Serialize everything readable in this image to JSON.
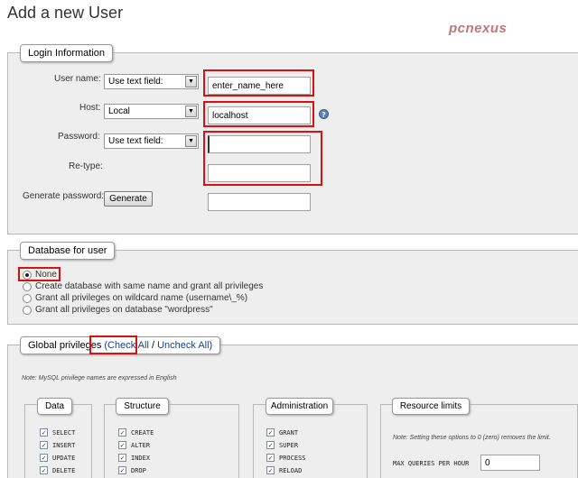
{
  "page": {
    "title": "Add a new User",
    "watermark": "pcnexus"
  },
  "login": {
    "legend": "Login Information",
    "username_label": "User name:",
    "username_mode": "Use text field:",
    "username_value": "enter_name_here",
    "host_label": "Host:",
    "host_mode": "Local",
    "host_value": "localhost",
    "password_label": "Password:",
    "password_mode": "Use text field:",
    "password_value": "",
    "retype_label": "Re-type:",
    "retype_value": "",
    "generate_label": "Generate password:",
    "generate_button": "Generate",
    "generated_value": ""
  },
  "database": {
    "legend": "Database for user",
    "options": [
      {
        "label": "None",
        "checked": true
      },
      {
        "label": "Create database with same name and grant all privileges",
        "checked": false
      },
      {
        "label": "Grant all privileges on wildcard name (username\\_%)",
        "checked": false
      },
      {
        "label": "Grant all privileges on database \"wordpress\"",
        "checked": false
      }
    ]
  },
  "global": {
    "legend_prefix": "Global privileges ",
    "check_all": "(Check All",
    "separator": " / ",
    "uncheck_all": "Uncheck All)",
    "note": "Note: MySQL privilege names are expressed in English",
    "groups": {
      "data": {
        "label": "Data",
        "items": [
          "SELECT",
          "INSERT",
          "UPDATE",
          "DELETE"
        ]
      },
      "structure": {
        "label": "Structure",
        "items": [
          "CREATE",
          "ALTER",
          "INDEX",
          "DROP"
        ]
      },
      "administration": {
        "label": "Administration",
        "items": [
          "GRANT",
          "SUPER",
          "PROCESS",
          "RELOAD"
        ]
      },
      "resource": {
        "label": "Resource limits",
        "note": "Note: Setting these options to 0 (zero) removes the limit.",
        "max_queries_label": "MAX QUERIES PER HOUR",
        "max_queries_value": "0"
      }
    }
  },
  "colors": {
    "highlight": "#dd1010",
    "panel": "#eeeeee",
    "link": "#1a3f8a"
  }
}
